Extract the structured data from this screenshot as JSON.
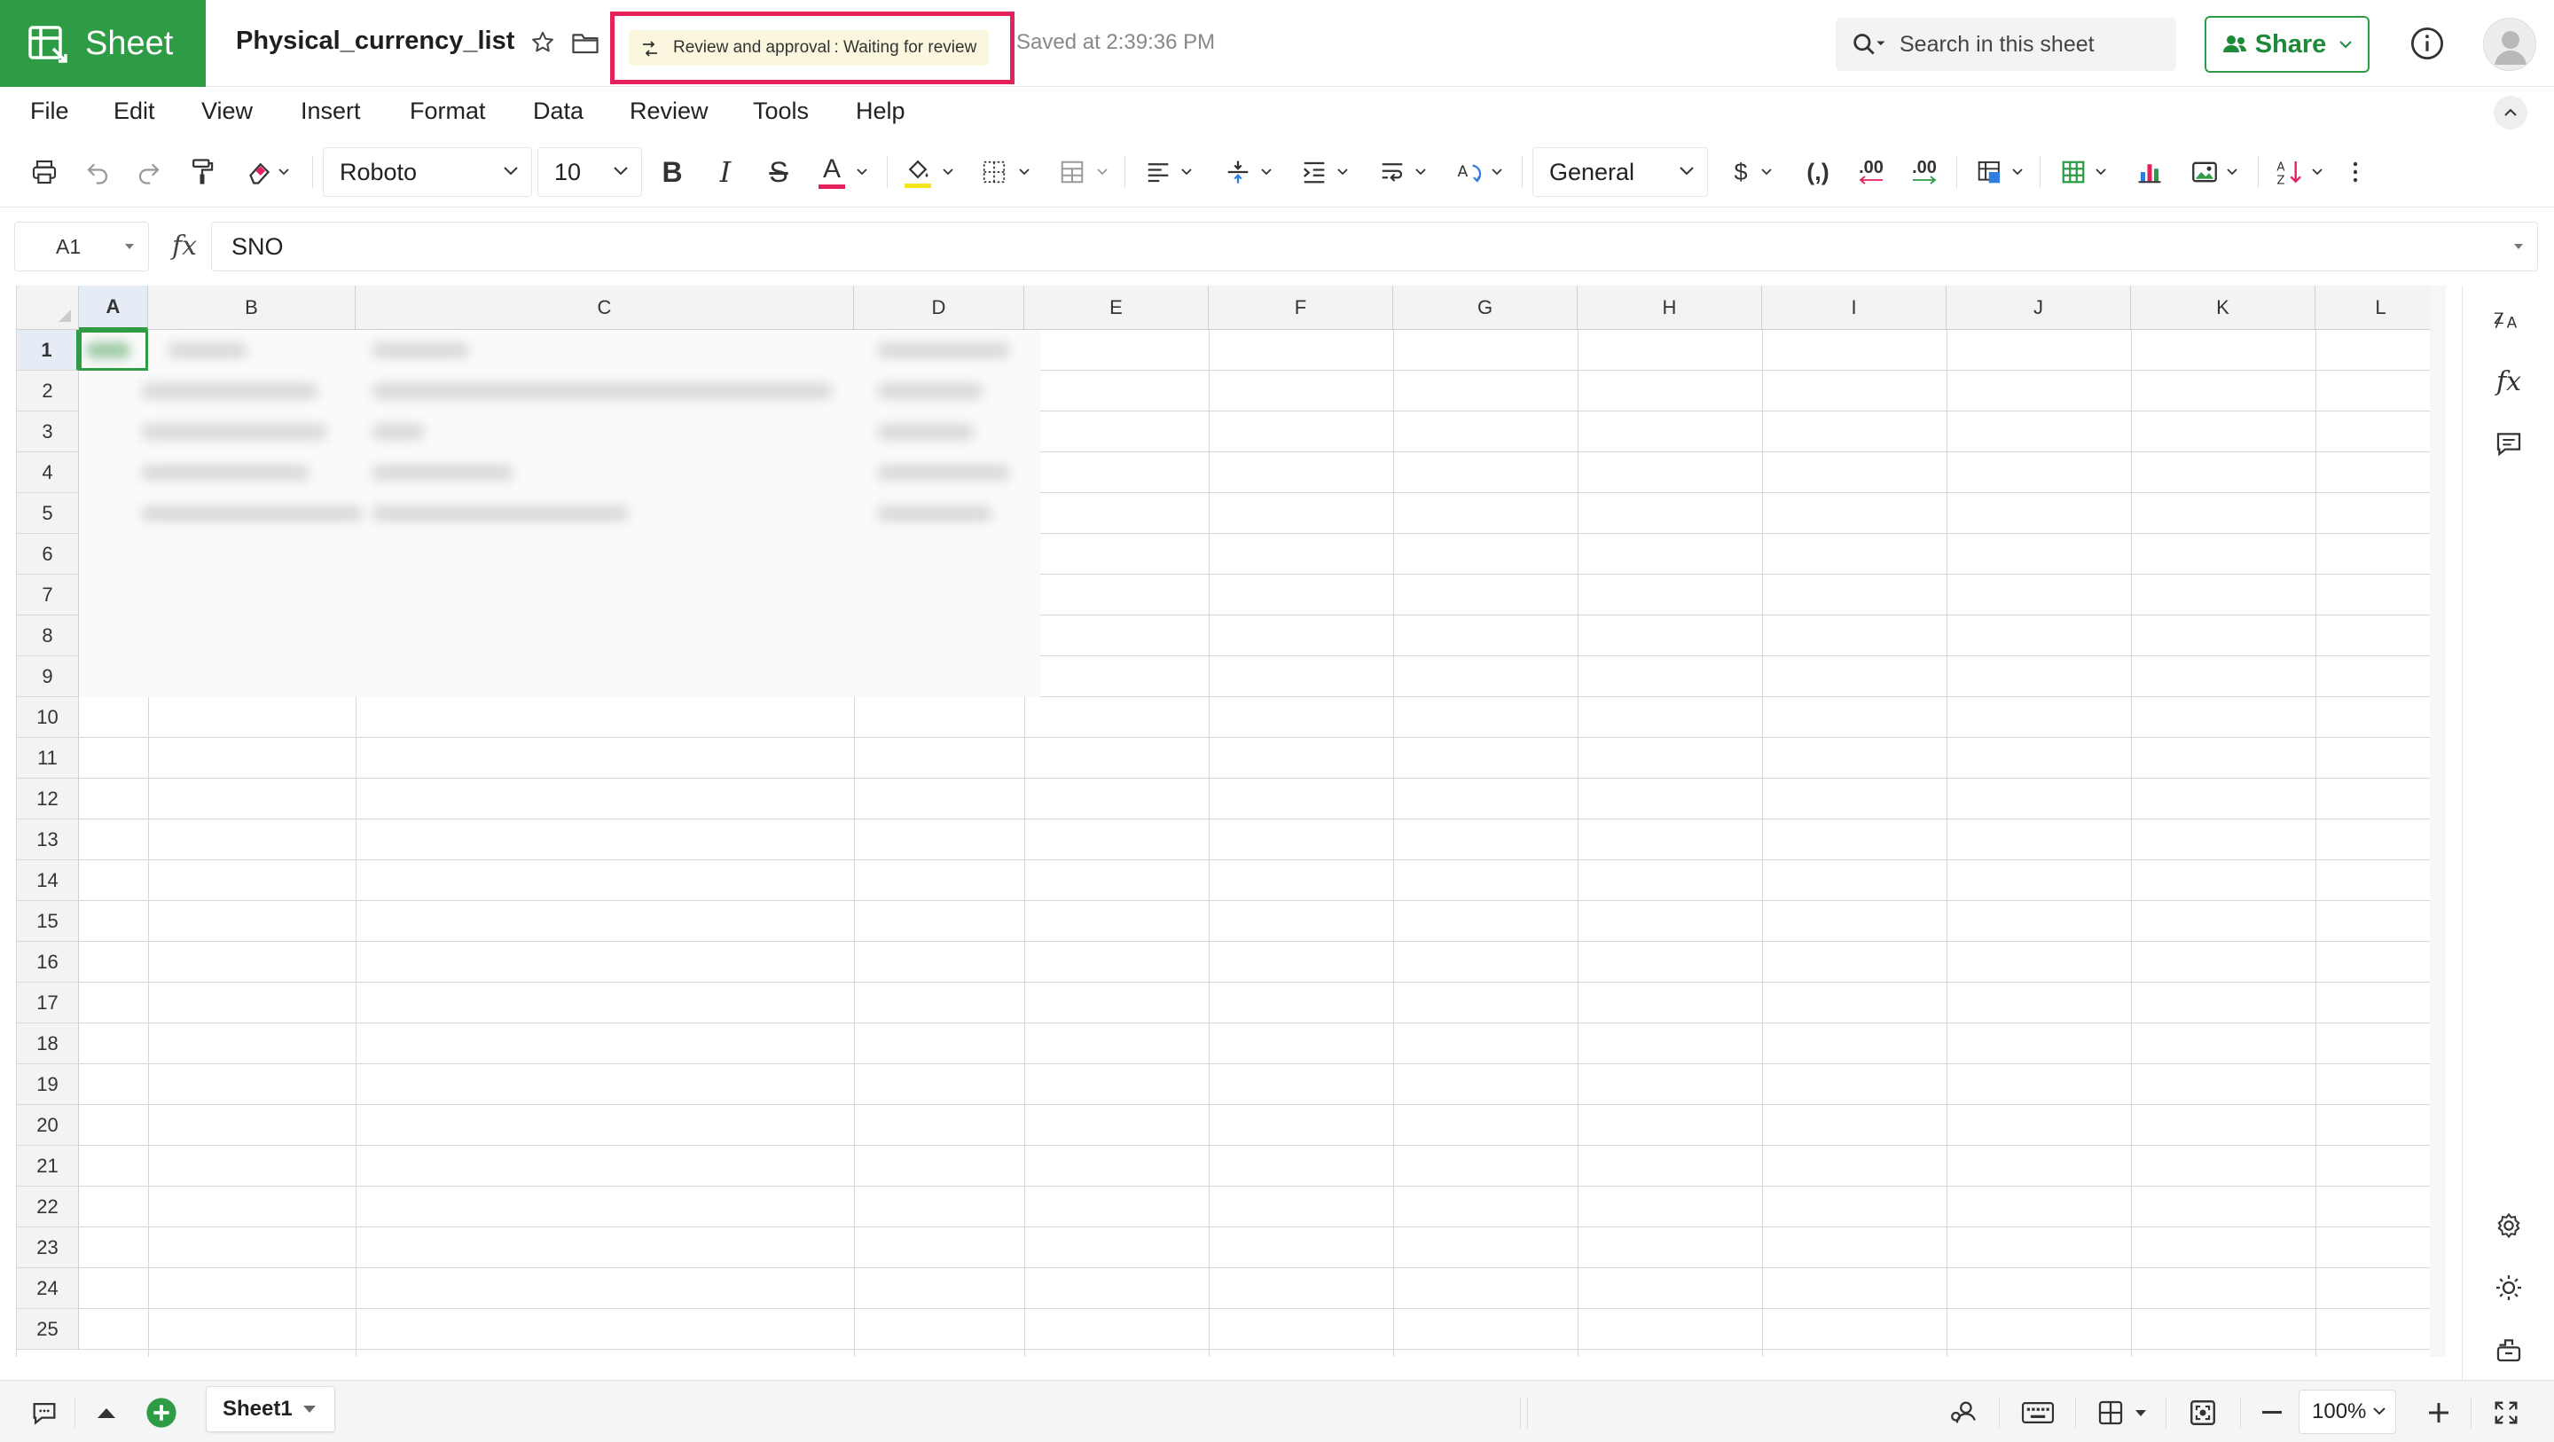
{
  "app": {
    "name": "Sheet",
    "accent": "#2e9b45"
  },
  "document": {
    "title": "Physical_currency_list",
    "saved": "Saved at 2:39:36 PM"
  },
  "review": {
    "label": "Review and approval",
    "status": " : Waiting for review",
    "highlight_color": "#e5215b"
  },
  "search": {
    "placeholder": "Search in this sheet"
  },
  "share": {
    "label": "Share"
  },
  "menu": [
    "File",
    "Edit",
    "View",
    "Insert",
    "Format",
    "Data",
    "Review",
    "Tools",
    "Help"
  ],
  "toolbar": {
    "font": "Roboto",
    "font_size": "10",
    "number_format": "General",
    "currency_symbol": "$",
    "comma_style": "(,)",
    "decrease_decimal": ".00",
    "increase_decimal": ".00",
    "bold": "B",
    "italic": "I",
    "strike": "S",
    "text_color_letter": "A",
    "text_color": "#e5215b",
    "fill_color": "#f5e51d"
  },
  "formula_bar": {
    "cell_ref": "A1",
    "fx": "fx",
    "value": "SNO"
  },
  "grid": {
    "columns": [
      "A",
      "B",
      "C",
      "D",
      "E",
      "F",
      "G",
      "H",
      "I",
      "J",
      "K",
      "L"
    ],
    "rows": [
      "1",
      "2",
      "3",
      "4",
      "5",
      "6",
      "7",
      "8",
      "9",
      "10",
      "11",
      "12",
      "13",
      "14",
      "15",
      "16",
      "17",
      "18",
      "19",
      "20",
      "21",
      "22",
      "23",
      "24",
      "25"
    ],
    "selected_cell": "A1"
  },
  "sheets": [
    {
      "name": "Sheet1"
    }
  ],
  "status": {
    "zoom": "100%"
  }
}
